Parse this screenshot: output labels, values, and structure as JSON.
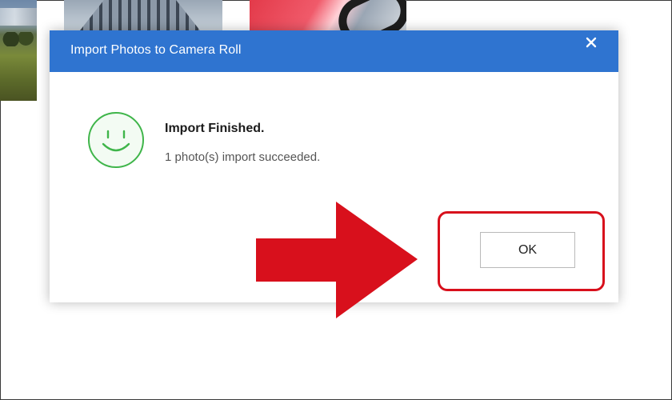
{
  "dialog": {
    "title": "Import Photos to Camera Roll",
    "close_label": "✕",
    "message_title": "Import Finished.",
    "message_detail": "1 photo(s) import succeeded.",
    "ok_label": "OK",
    "status_icon": "smiley-face-icon"
  },
  "colors": {
    "title_bar": "#2f74d0",
    "success_green": "#3fb54a",
    "annotation_red": "#d8101c"
  },
  "annotation": {
    "arrow_icon": "arrow-right-icon",
    "highlight_target": "ok-button"
  }
}
